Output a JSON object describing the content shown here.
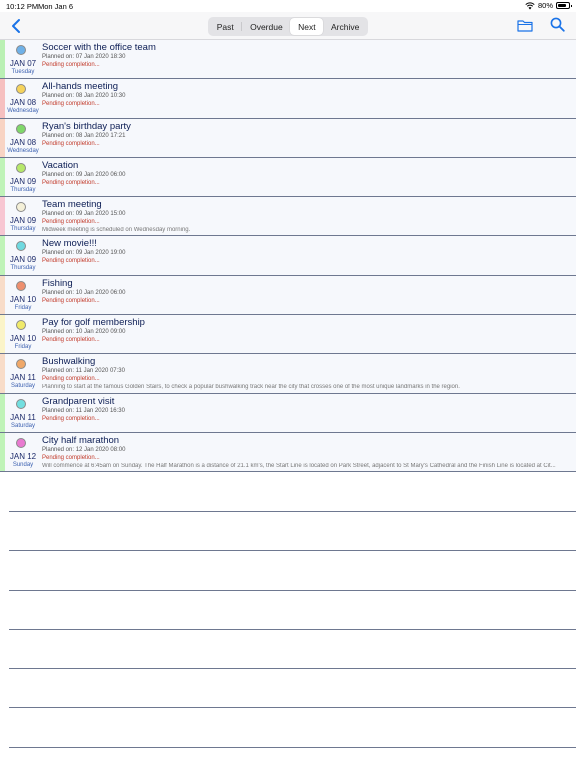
{
  "status_bar": {
    "time": "10:12 PM",
    "date": "Mon Jan 6",
    "battery": "80%",
    "battery_level": 0.8
  },
  "nav": {
    "back_icon": "chevron-left-icon",
    "tabs": [
      {
        "label": "Past",
        "active": false
      },
      {
        "label": "Overdue",
        "active": false
      },
      {
        "label": "Next",
        "active": true
      },
      {
        "label": "Archive",
        "active": false
      }
    ],
    "folder_icon": "folder-icon",
    "search_icon": "search-icon",
    "accent_color": "#1a73e8"
  },
  "events": [
    {
      "title": "Soccer with the office team",
      "planned": "Planned on: 07 Jan 2020 18:30",
      "status": "Pending completion...",
      "note": "",
      "date": "JAN 07",
      "day": "Tuesday",
      "dot_color": "#6fb1e8",
      "stripe_color": "#b9f0b4"
    },
    {
      "title": "All-hands meeting",
      "planned": "Planned on: 08 Jan 2020 10:30",
      "status": "Pending completion...",
      "note": "",
      "date": "JAN 08",
      "day": "Wednesday",
      "dot_color": "#f5d35c",
      "stripe_color": "#f6c0c0"
    },
    {
      "title": "Ryan's birthday party",
      "planned": "Planned on: 08 Jan 2020 17:21",
      "status": "Pending completion...",
      "note": "",
      "date": "JAN 08",
      "day": "Wednesday",
      "dot_color": "#7fd86a",
      "stripe_color": "#f8d4c4"
    },
    {
      "title": "Vacation",
      "planned": "Planned on: 09 Jan 2020 06:00",
      "status": "Pending completion...",
      "note": "",
      "date": "JAN 09",
      "day": "Thursday",
      "dot_color": "#b6e86a",
      "stripe_color": "#bff3b8"
    },
    {
      "title": "Team meeting",
      "planned": "Planned on: 09 Jan 2020 15:00",
      "status": "Pending completion...",
      "note": "Midweek meeting is scheduled on Wednesday morning.",
      "date": "JAN 09",
      "day": "Thursday",
      "dot_color": "#f4f0d8",
      "stripe_color": "#f7c6d2"
    },
    {
      "title": "New movie!!!",
      "planned": "Planned on: 09 Jan 2020 19:00",
      "status": "Pending completion...",
      "note": "",
      "date": "JAN 09",
      "day": "Thursday",
      "dot_color": "#6fd9e0",
      "stripe_color": "#bff3b8"
    },
    {
      "title": "Fishing",
      "planned": "Planned on: 10 Jan 2020 06:00",
      "status": "Pending completion...",
      "note": "",
      "date": "JAN 10",
      "day": "Friday",
      "dot_color": "#ee8f6e",
      "stripe_color": "#f8dcc8"
    },
    {
      "title": "Pay for golf membership",
      "planned": "Planned on: 10 Jan 2020 09:00",
      "status": "Pending completion...",
      "note": "",
      "date": "JAN 10",
      "day": "Friday",
      "dot_color": "#f0ea6a",
      "stripe_color": "#fbf4c8"
    },
    {
      "title": "Bushwalking",
      "planned": "Planned on: 11 Jan 2020 07:30",
      "status": "Pending completion...",
      "note": "Planning to start at the famous Golden Stairs, to check a popular bushwalking track near the city that crosses one of the most unique landmarks in the region.",
      "date": "JAN 11",
      "day": "Saturday",
      "dot_color": "#f0a868",
      "stripe_color": "#f8dcc8"
    },
    {
      "title": "Grandparent visit",
      "planned": "Planned on: 11 Jan 2020 16:30",
      "status": "Pending completion...",
      "note": "",
      "date": "JAN 11",
      "day": "Saturday",
      "dot_color": "#72dfe0",
      "stripe_color": "#bff3b8"
    },
    {
      "title": "City half marathon",
      "planned": "Planned on: 12 Jan 2020 08:00",
      "status": "Pending completion...",
      "note": "Will commence at 6:45am on Sunday. The Half Marathon is a distance of 21.1 km's, the Start Line is located on Park Street, adjacent to St Mary's Cathedral and the Finish Line is located at Cit...",
      "date": "JAN 12",
      "day": "Sunday",
      "dot_color": "#e87ad0",
      "stripe_color": "#bff3b8"
    }
  ]
}
